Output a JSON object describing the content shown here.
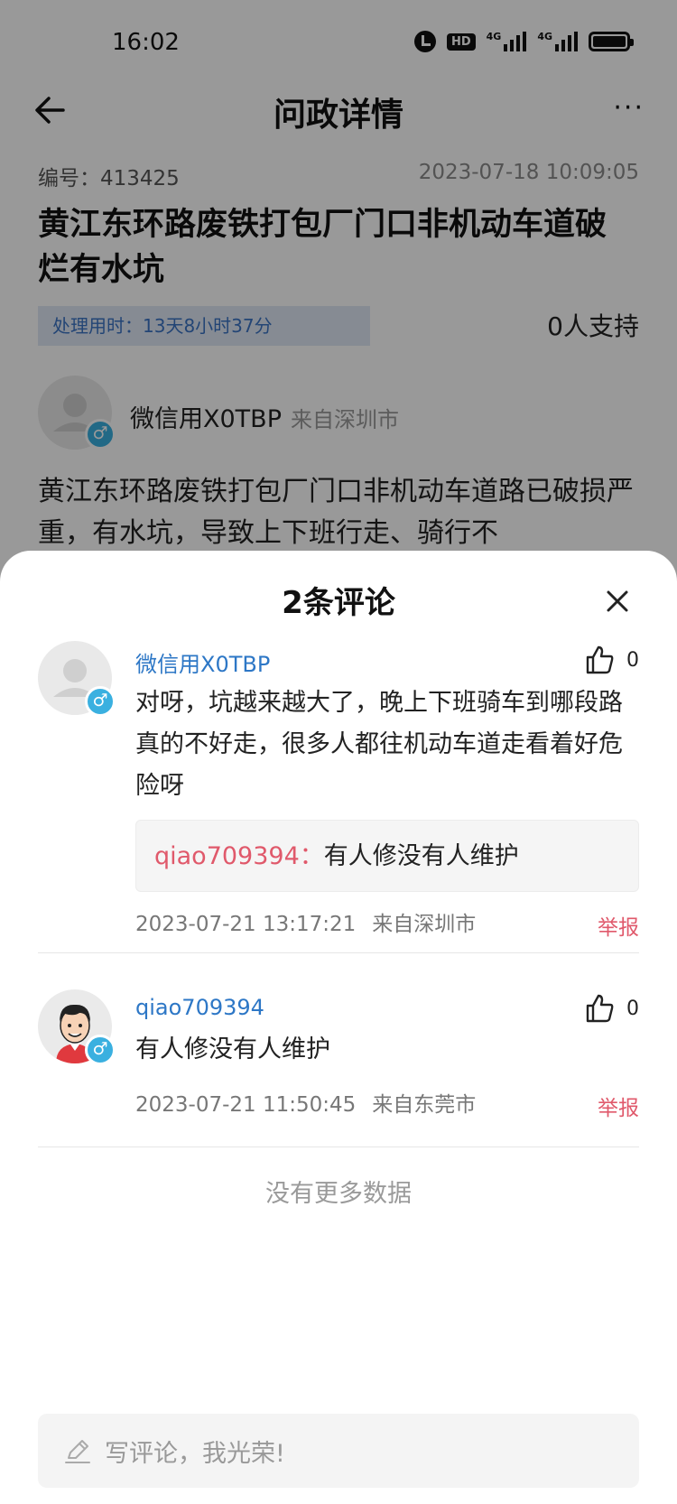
{
  "status_bar": {
    "time": "16:02",
    "hd_label": "HD",
    "net1": "4G",
    "net2": "4G"
  },
  "nav": {
    "title": "问政详情",
    "more": "···"
  },
  "issue": {
    "id_label": "编号：413425",
    "timestamp": "2023-07-18 10:09:05",
    "title": "黄江东环路废铁打包厂门口非机动车道破烂有水坑",
    "processing_time": "处理用时：13天8小时37分",
    "support": "0人支持",
    "author_name": "微信用X0TBP",
    "author_from": "来自深圳市",
    "body": "黄江东环路废铁打包厂门口非机动车道路已破损严重，有水坑，导致上下班行走、骑行不"
  },
  "sheet": {
    "title": "2条评论",
    "comments": [
      {
        "user": "微信用X0TBP",
        "likes": "0",
        "text": "对呀，坑越来越大了，晚上下班骑车到哪段路真的不好走，很多人都往机动车道走看着好危险呀",
        "reply_user": "qiao709394：",
        "reply_text": "有人修没有人维护",
        "time": "2023-07-21 13:17:21",
        "from": "来自深圳市",
        "report": "举报"
      },
      {
        "user": "qiao709394",
        "likes": "0",
        "text": "有人修没有人维护",
        "time": "2023-07-21 11:50:45",
        "from": "来自东莞市",
        "report": "举报"
      }
    ],
    "no_more": "没有更多数据",
    "write_placeholder": "写评论，我光荣!"
  },
  "colors": {
    "accent_blue": "#2d77c6",
    "report_red": "#e0596b",
    "gender_blue": "#3ab0e0"
  },
  "icons": [
    "back-arrow-icon",
    "more-icon",
    "close-icon",
    "thumb-up-icon",
    "male-icon",
    "pen-icon",
    "alarm-icon",
    "battery-icon"
  ]
}
